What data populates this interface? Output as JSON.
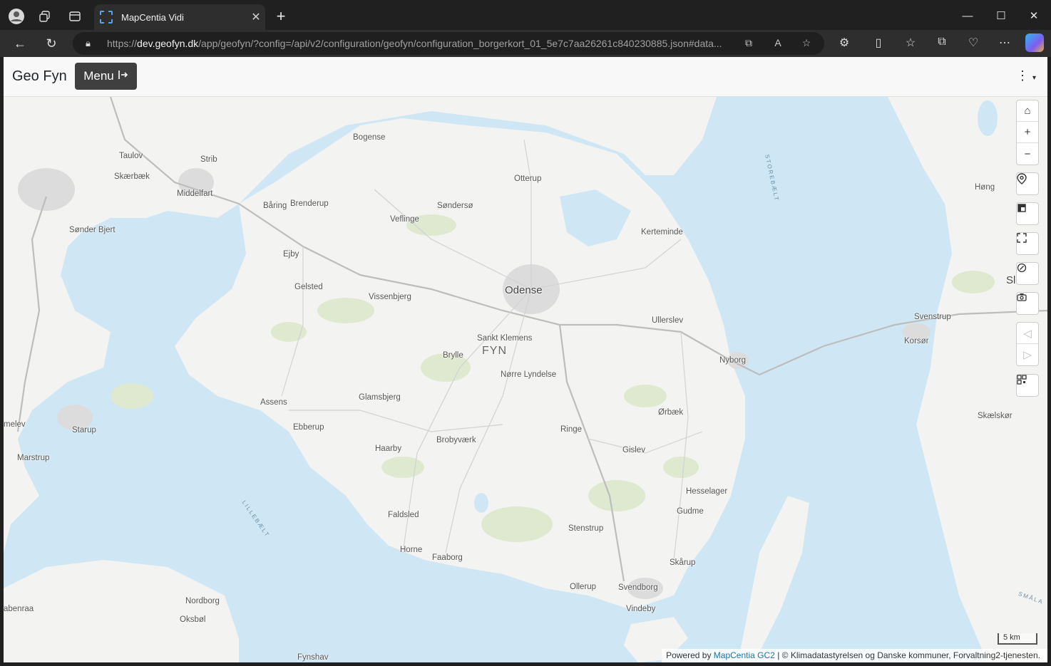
{
  "browser": {
    "tab_title": "MapCentia Vidi",
    "url_prefix": "https://",
    "url_host": "dev.geofyn.dk",
    "url_rest": "/app/geofyn/?config=/api/v2/configuration/geofyn/configuration_borgerkort_01_5e7c7aa26261c840230885.json#data..."
  },
  "app": {
    "brand": "Geo Fyn",
    "menu_label": "Menu"
  },
  "map": {
    "places": [
      {
        "name": "Bogense",
        "key": "bogense"
      },
      {
        "name": "Taulov",
        "key": "taulov"
      },
      {
        "name": "Strib",
        "key": "strib"
      },
      {
        "name": "Skærbæk",
        "key": "skaerbaek"
      },
      {
        "name": "Middelfart",
        "key": "middelfart"
      },
      {
        "name": "Otterup",
        "key": "otterup"
      },
      {
        "name": "Båring",
        "key": "baaring"
      },
      {
        "name": "Brenderup",
        "key": "brenderup"
      },
      {
        "name": "Søndersø",
        "key": "sondersoe"
      },
      {
        "name": "Veflinge",
        "key": "veflinge"
      },
      {
        "name": "Sønder Bjert",
        "key": "sonder-bjert"
      },
      {
        "name": "Kerteminde",
        "key": "kerteminde"
      },
      {
        "name": "Høng",
        "key": "hong"
      },
      {
        "name": "Ejby",
        "key": "ejby"
      },
      {
        "name": "Gelsted",
        "key": "gelsted"
      },
      {
        "name": "Odense",
        "key": "odense"
      },
      {
        "name": "Vissenbjerg",
        "key": "vissenbjerg"
      },
      {
        "name": "Sl",
        "key": "slagelse-fragment"
      },
      {
        "name": "Ullerslev",
        "key": "ullerslev"
      },
      {
        "name": "Svenstrup",
        "key": "svenstrup"
      },
      {
        "name": "Sankt Klemens",
        "key": "sankt-klemens"
      },
      {
        "name": "Korsør",
        "key": "korsor"
      },
      {
        "name": "FYN",
        "key": "fyn"
      },
      {
        "name": "Brylle",
        "key": "brylle"
      },
      {
        "name": "Nyborg",
        "key": "nyborg"
      },
      {
        "name": "Nørre Lyndelse",
        "key": "norre-lyndelse"
      },
      {
        "name": "Glamsbjerg",
        "key": "glamsbjerg"
      },
      {
        "name": "Assens",
        "key": "assens"
      },
      {
        "name": "Ørbæk",
        "key": "orbaek"
      },
      {
        "name": "Skælskør",
        "key": "skaelskor"
      },
      {
        "name": "melev",
        "key": "melev"
      },
      {
        "name": "Starup",
        "key": "starup"
      },
      {
        "name": "Ebberup",
        "key": "ebberup"
      },
      {
        "name": "Ringe",
        "key": "ringe"
      },
      {
        "name": "Brobyværk",
        "key": "brobyvaerk"
      },
      {
        "name": "Haarby",
        "key": "haarby"
      },
      {
        "name": "Gislev",
        "key": "gislev"
      },
      {
        "name": "Marstrup",
        "key": "marstrup"
      },
      {
        "name": "Hesselager",
        "key": "hesselager"
      },
      {
        "name": "Gudme",
        "key": "gudme"
      },
      {
        "name": "Faldsled",
        "key": "faldsled"
      },
      {
        "name": "Stenstrup",
        "key": "stenstrup"
      },
      {
        "name": "Horne",
        "key": "horne"
      },
      {
        "name": "Faaborg",
        "key": "faaborg"
      },
      {
        "name": "Skårup",
        "key": "skaarup"
      },
      {
        "name": "Nordborg",
        "key": "nordborg"
      },
      {
        "name": "Ollerup",
        "key": "ollerup"
      },
      {
        "name": "Svendborg",
        "key": "svendborg"
      },
      {
        "name": "abenraa",
        "key": "aabenraa"
      },
      {
        "name": "Vindeby",
        "key": "vindeby"
      },
      {
        "name": "Oksbøl",
        "key": "oksbol"
      },
      {
        "name": "Fynshav",
        "key": "fynshav"
      }
    ],
    "water_labels": {
      "storebaelt": "STOREBÆLT",
      "lillebaelt": "LILLEBÆLT",
      "smaalandsfarvandet": "SMÅLA"
    },
    "scale_label": "5 km",
    "attribution": {
      "prefix": "Powered by",
      "link": "MapCentia GC2",
      "suffix": "| © Klimadatastyrelsen og Danske kommuner, Forvaltning2-tjenesten."
    }
  }
}
